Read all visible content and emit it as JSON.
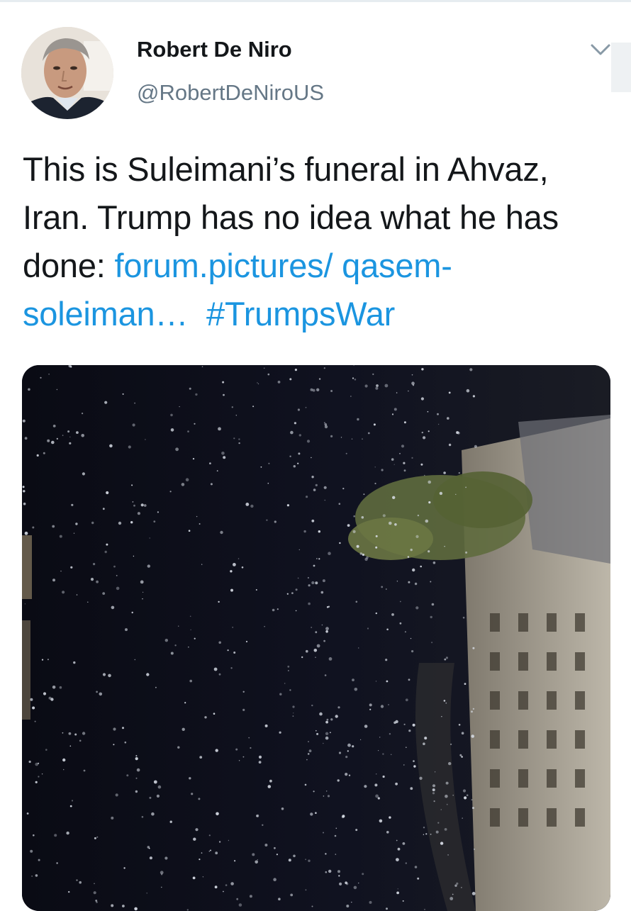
{
  "tweet": {
    "display_name": "Robert De Niro",
    "handle": "@RobertDeNiroUS",
    "text_plain": "This is Suleimani’s funeral in Ahvaz, Iran. Trump has no idea what he has done: ",
    "link_text": "forum.pictures/ qasem-soleiman…",
    "hashtag": "#TrumpsWar"
  },
  "icons": {
    "avatar": "profile-photo",
    "menu": "chevron-down-icon"
  },
  "colors": {
    "link": "#1b95e0",
    "text": "#14171a",
    "secondary": "#657786"
  }
}
